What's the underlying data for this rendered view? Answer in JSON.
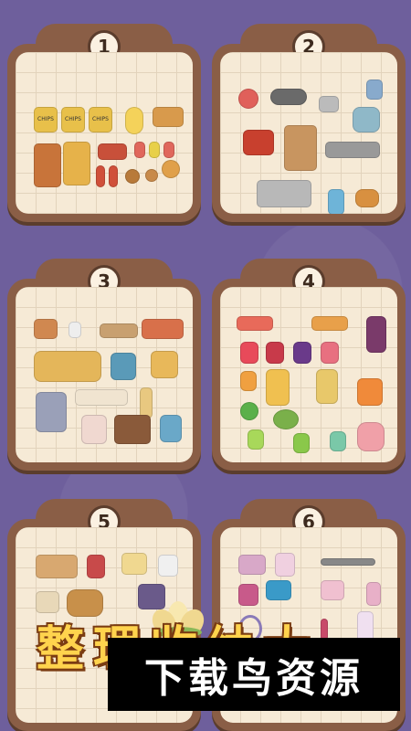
{
  "levels": [
    {
      "number": "1",
      "theme": "snacks",
      "chips_label": "CHIPS"
    },
    {
      "number": "2",
      "theme": "kitchen"
    },
    {
      "number": "3",
      "theme": "furniture"
    },
    {
      "number": "4",
      "theme": "drinks"
    },
    {
      "number": "5",
      "theme": "bakery"
    },
    {
      "number": "6",
      "theme": "cosmetics"
    }
  ],
  "title": {
    "text": "整理收纳大"
  },
  "watermark": {
    "text": "下载鸟资源"
  },
  "colors": {
    "background": "#6e5f9c",
    "card": "#8a5e46",
    "panel": "#f6ead6",
    "title": "#ffd34d"
  }
}
